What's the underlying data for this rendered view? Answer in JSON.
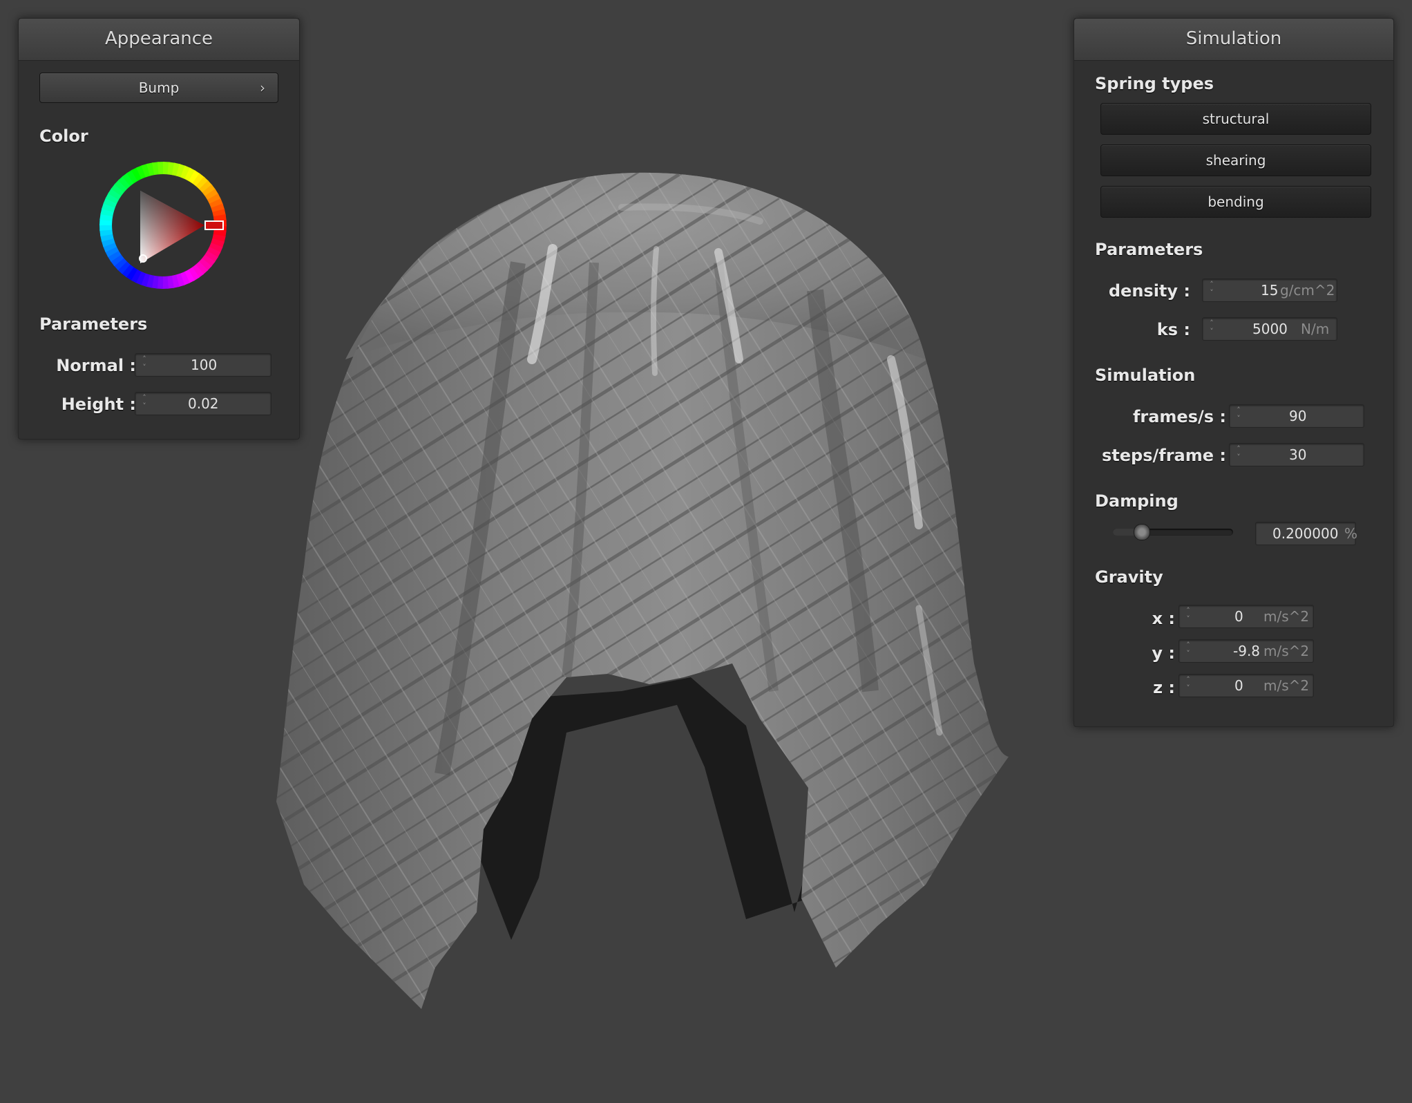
{
  "appearance": {
    "title": "Appearance",
    "bump_button": "Bump",
    "bump_chevron": "›",
    "color_label": "Color",
    "parameters_label": "Parameters",
    "normal": {
      "label": "Normal :",
      "value": "100"
    },
    "height": {
      "label": "Height :",
      "value": "0.02"
    },
    "selected_color": "#d01010"
  },
  "simulation": {
    "title": "Simulation",
    "spring_types_label": "Spring types",
    "spring_types": [
      "structural",
      "shearing",
      "bending"
    ],
    "parameters_label": "Parameters",
    "density": {
      "label": "density :",
      "value": "15",
      "unit": "g/cm^2"
    },
    "ks": {
      "label": "ks :",
      "value": "5000",
      "unit": "N/m"
    },
    "simulation_label": "Simulation",
    "frames_per_second": {
      "label": "frames/s :",
      "value": "90"
    },
    "steps_per_frame": {
      "label": "steps/frame :",
      "value": "30"
    },
    "damping_label": "Damping",
    "damping": {
      "value": "0.200000",
      "unit": "%",
      "slider_fraction": 0.2
    },
    "gravity_label": "Gravity",
    "gravity": {
      "x": {
        "label": "x :",
        "value": "0",
        "unit": "m/s^2"
      },
      "y": {
        "label": "y :",
        "value": "-9.8",
        "unit": "m/s^2"
      },
      "z": {
        "label": "z :",
        "value": "0",
        "unit": "m/s^2"
      }
    }
  },
  "colors": {
    "background": "#404040",
    "panel": "#303030",
    "cloth": "#8a8a8a"
  }
}
